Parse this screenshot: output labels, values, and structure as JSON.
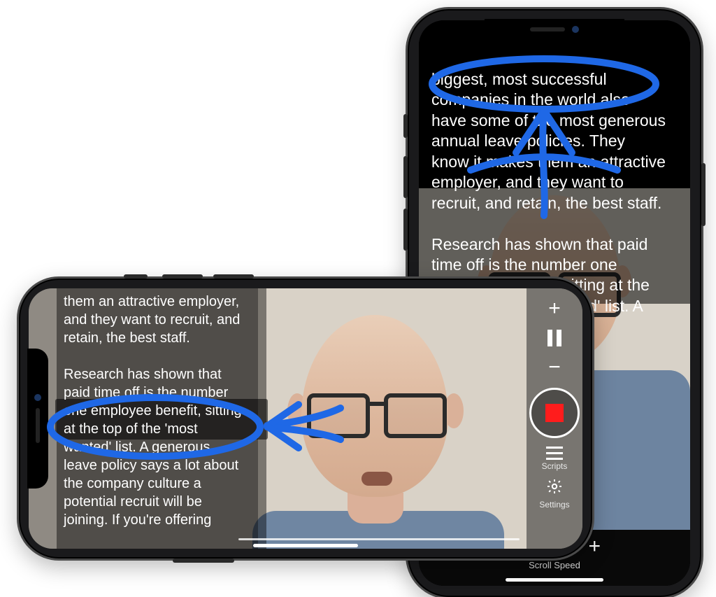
{
  "annotation_color": "#1f68e6",
  "portrait": {
    "script": {
      "line1": "biggest, most successful",
      "line2": "companies in the world also",
      "line3": "have some of the most generous",
      "line4": "annual leave policies. They",
      "line5": "know it makes them an attractive",
      "line6": "employer, and they want to",
      "line7": "recruit, and retain, the best staff.",
      "para2_line1": "Research has shown that paid",
      "para2_line2": "time off is the number one",
      "para2_line3": "employee benefit, sitting at the",
      "para2_line4_partial": "top of the 'most wanted' list. A"
    },
    "controls": {
      "speed_minus": "−",
      "speed_plus": "+",
      "speed_label": "Scroll Speed"
    }
  },
  "landscape": {
    "script": {
      "line0": "them an attractive employer,",
      "line1": "and they want to recruit, and",
      "line2": "retain, the best staff.",
      "p2_line1": "Research has shown that",
      "p2_line2": "paid time off is the number",
      "p2_line3": "one employee benefit, sitting",
      "p2_line4": "at the top of the 'most",
      "p2_line5": "wanted' list. A generous",
      "p2_line6": "leave policy says a lot about",
      "p2_line7": "the company culture a",
      "p2_line8": "potential recruit will be",
      "p2_line9": "joining. If you're offering"
    },
    "controls": {
      "plus": "+",
      "minus": "−",
      "scripts_label": "Scripts",
      "settings_label": "Settings"
    }
  }
}
